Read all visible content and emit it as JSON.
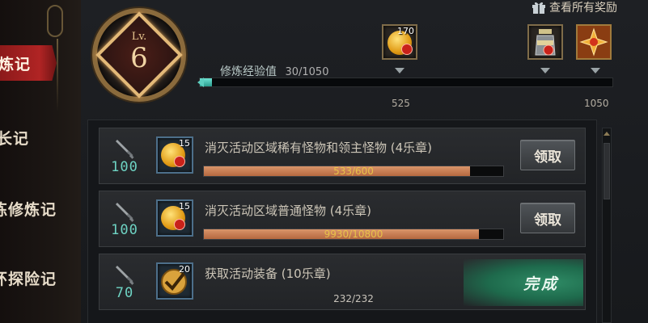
{
  "sidebar": {
    "items": [
      {
        "label": "炼记",
        "active": true
      },
      {
        "label": "长记",
        "active": false
      },
      {
        "label": "练修炼记",
        "active": false
      },
      {
        "label": "环探险记",
        "active": false
      }
    ]
  },
  "level": {
    "prefix": "Lv.",
    "value": "6"
  },
  "header": {
    "view_all_rewards": "查看所有奖励"
  },
  "xp": {
    "label": "修炼经验值",
    "value_text": "30/1050",
    "current": 30,
    "max": 1050,
    "ticks": [
      "525",
      "1050"
    ]
  },
  "milestone_rewards": [
    {
      "icon": "gold-coin-icon",
      "count": "170"
    },
    {
      "icon": "potion-jar-icon",
      "count": ""
    },
    {
      "icon": "gold-star-emblem-icon",
      "count": ""
    }
  ],
  "quests": [
    {
      "points": "100",
      "reward_count": "15",
      "title": "消灭活动区域稀有怪物和领主怪物 (4乐章)",
      "progress_text": "533/600",
      "progress": 0.888,
      "button": "领取",
      "completed": false
    },
    {
      "points": "100",
      "reward_count": "15",
      "title": "消灭活动区域普通怪物 (4乐章)",
      "progress_text": "9930/10800",
      "progress": 0.919,
      "button": "领取",
      "completed": false
    },
    {
      "points": "70",
      "reward_count": "20",
      "title": "获取活动装备 (10乐章)",
      "progress_text": "232/232",
      "progress": 1.0,
      "button": "完成",
      "completed": true
    }
  ],
  "colors": {
    "accent_red": "#b02424",
    "xp_teal": "#5ccfc0",
    "progress_orange": "#d9956a",
    "complete_green": "#2f8c66"
  }
}
